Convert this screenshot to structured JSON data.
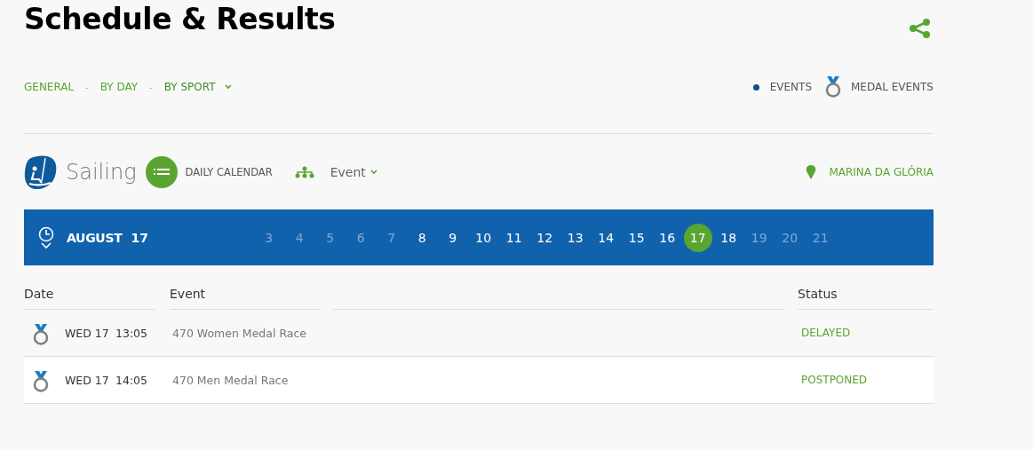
{
  "page_title": "Schedule & Results",
  "view_tab_separators": [
    "-",
    "-"
  ],
  "view_tabs": [
    {
      "label": "GENERAL",
      "selected": false
    },
    {
      "label": "BY DAY",
      "selected": false
    },
    {
      "label": "BY SPORT",
      "selected": true
    }
  ],
  "legend": [
    {
      "kind": "dot",
      "label": "EVENTS"
    },
    {
      "kind": "medal",
      "label": "MEDAL EVENTS"
    }
  ],
  "sport": {
    "name": "Sailing",
    "calendar_label": "DAILY CALENDAR",
    "event_dropdown": "Event",
    "venue": "MARINA DA GLÓRIA"
  },
  "day_bar": {
    "month": "AUGUST",
    "day": "17",
    "days": [
      {
        "label": "3",
        "disabled": true,
        "selected": false
      },
      {
        "label": "4",
        "disabled": true,
        "selected": false
      },
      {
        "label": "5",
        "disabled": true,
        "selected": false
      },
      {
        "label": "6",
        "disabled": true,
        "selected": false
      },
      {
        "label": "7",
        "disabled": true,
        "selected": false
      },
      {
        "label": "8",
        "disabled": false,
        "selected": false
      },
      {
        "label": "9",
        "disabled": false,
        "selected": false
      },
      {
        "label": "10",
        "disabled": false,
        "selected": false
      },
      {
        "label": "11",
        "disabled": false,
        "selected": false
      },
      {
        "label": "12",
        "disabled": false,
        "selected": false
      },
      {
        "label": "13",
        "disabled": false,
        "selected": false
      },
      {
        "label": "14",
        "disabled": false,
        "selected": false
      },
      {
        "label": "15",
        "disabled": false,
        "selected": false
      },
      {
        "label": "16",
        "disabled": false,
        "selected": false
      },
      {
        "label": "17",
        "disabled": false,
        "selected": true
      },
      {
        "label": "18",
        "disabled": false,
        "selected": false
      },
      {
        "label": "19",
        "disabled": true,
        "selected": false
      },
      {
        "label": "20",
        "disabled": true,
        "selected": false
      },
      {
        "label": "21",
        "disabled": true,
        "selected": false
      }
    ]
  },
  "table": {
    "columns": [
      "Date",
      "Event",
      "Status"
    ],
    "rows": [
      {
        "kind": "medal",
        "date": "WED 17",
        "time": "13:05",
        "event": "470 Women Medal Race",
        "status": "DELAYED"
      },
      {
        "kind": "medal",
        "date": "WED 17",
        "time": "14:05",
        "event": "470 Men Medal Race",
        "status": "POSTPONED"
      }
    ]
  }
}
